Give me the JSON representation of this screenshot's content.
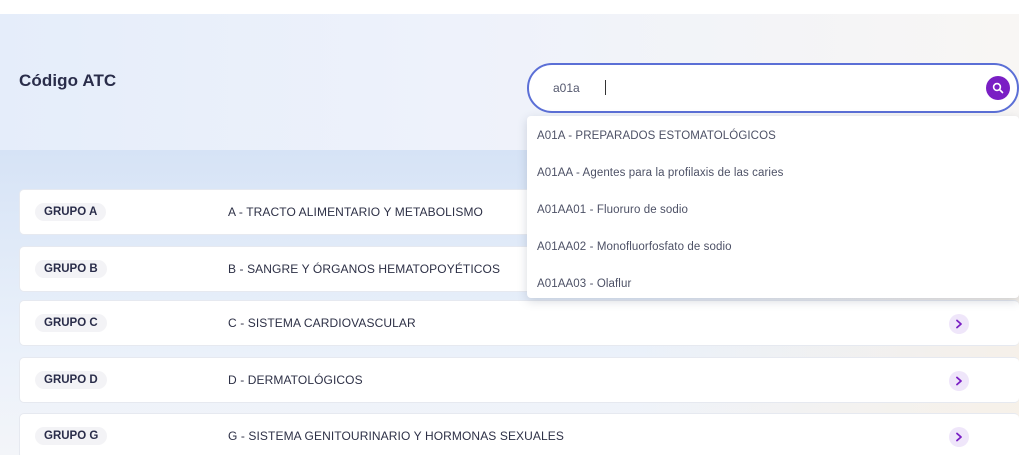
{
  "page": {
    "title": "Código ATC"
  },
  "search": {
    "value": "a01a",
    "placeholder": "",
    "button_icon": "search-icon",
    "accent_color": "#7a1fc4",
    "border_color": "#5b6fd6"
  },
  "suggestions": [
    "A01A - PREPARADOS ESTOMATOLÓGICOS",
    "A01AA - Agentes para la profilaxis de las caries",
    "A01AA01 - Fluoruro de sodio",
    "A01AA02 - Monofluorfosfato de sodio",
    "A01AA03 - Olaflur"
  ],
  "groups": [
    {
      "badge": "GRUPO A",
      "label": "A - TRACTO ALIMENTARIO Y METABOLISMO",
      "icon": "chevron-right-icon"
    },
    {
      "badge": "GRUPO B",
      "label": "B - SANGRE Y ÓRGANOS HEMATOPOYÉTICOS",
      "icon": "chevron-right-icon"
    },
    {
      "badge": "GRUPO C",
      "label": "C - SISTEMA CARDIOVASCULAR",
      "icon": "chevron-right-icon"
    },
    {
      "badge": "GRUPO D",
      "label": "D - DERMATOLÓGICOS",
      "icon": "chevron-right-icon"
    },
    {
      "badge": "GRUPO G",
      "label": "G - SISTEMA GENITOURINARIO Y HORMONAS SEXUALES",
      "icon": "chevron-right-icon"
    }
  ]
}
